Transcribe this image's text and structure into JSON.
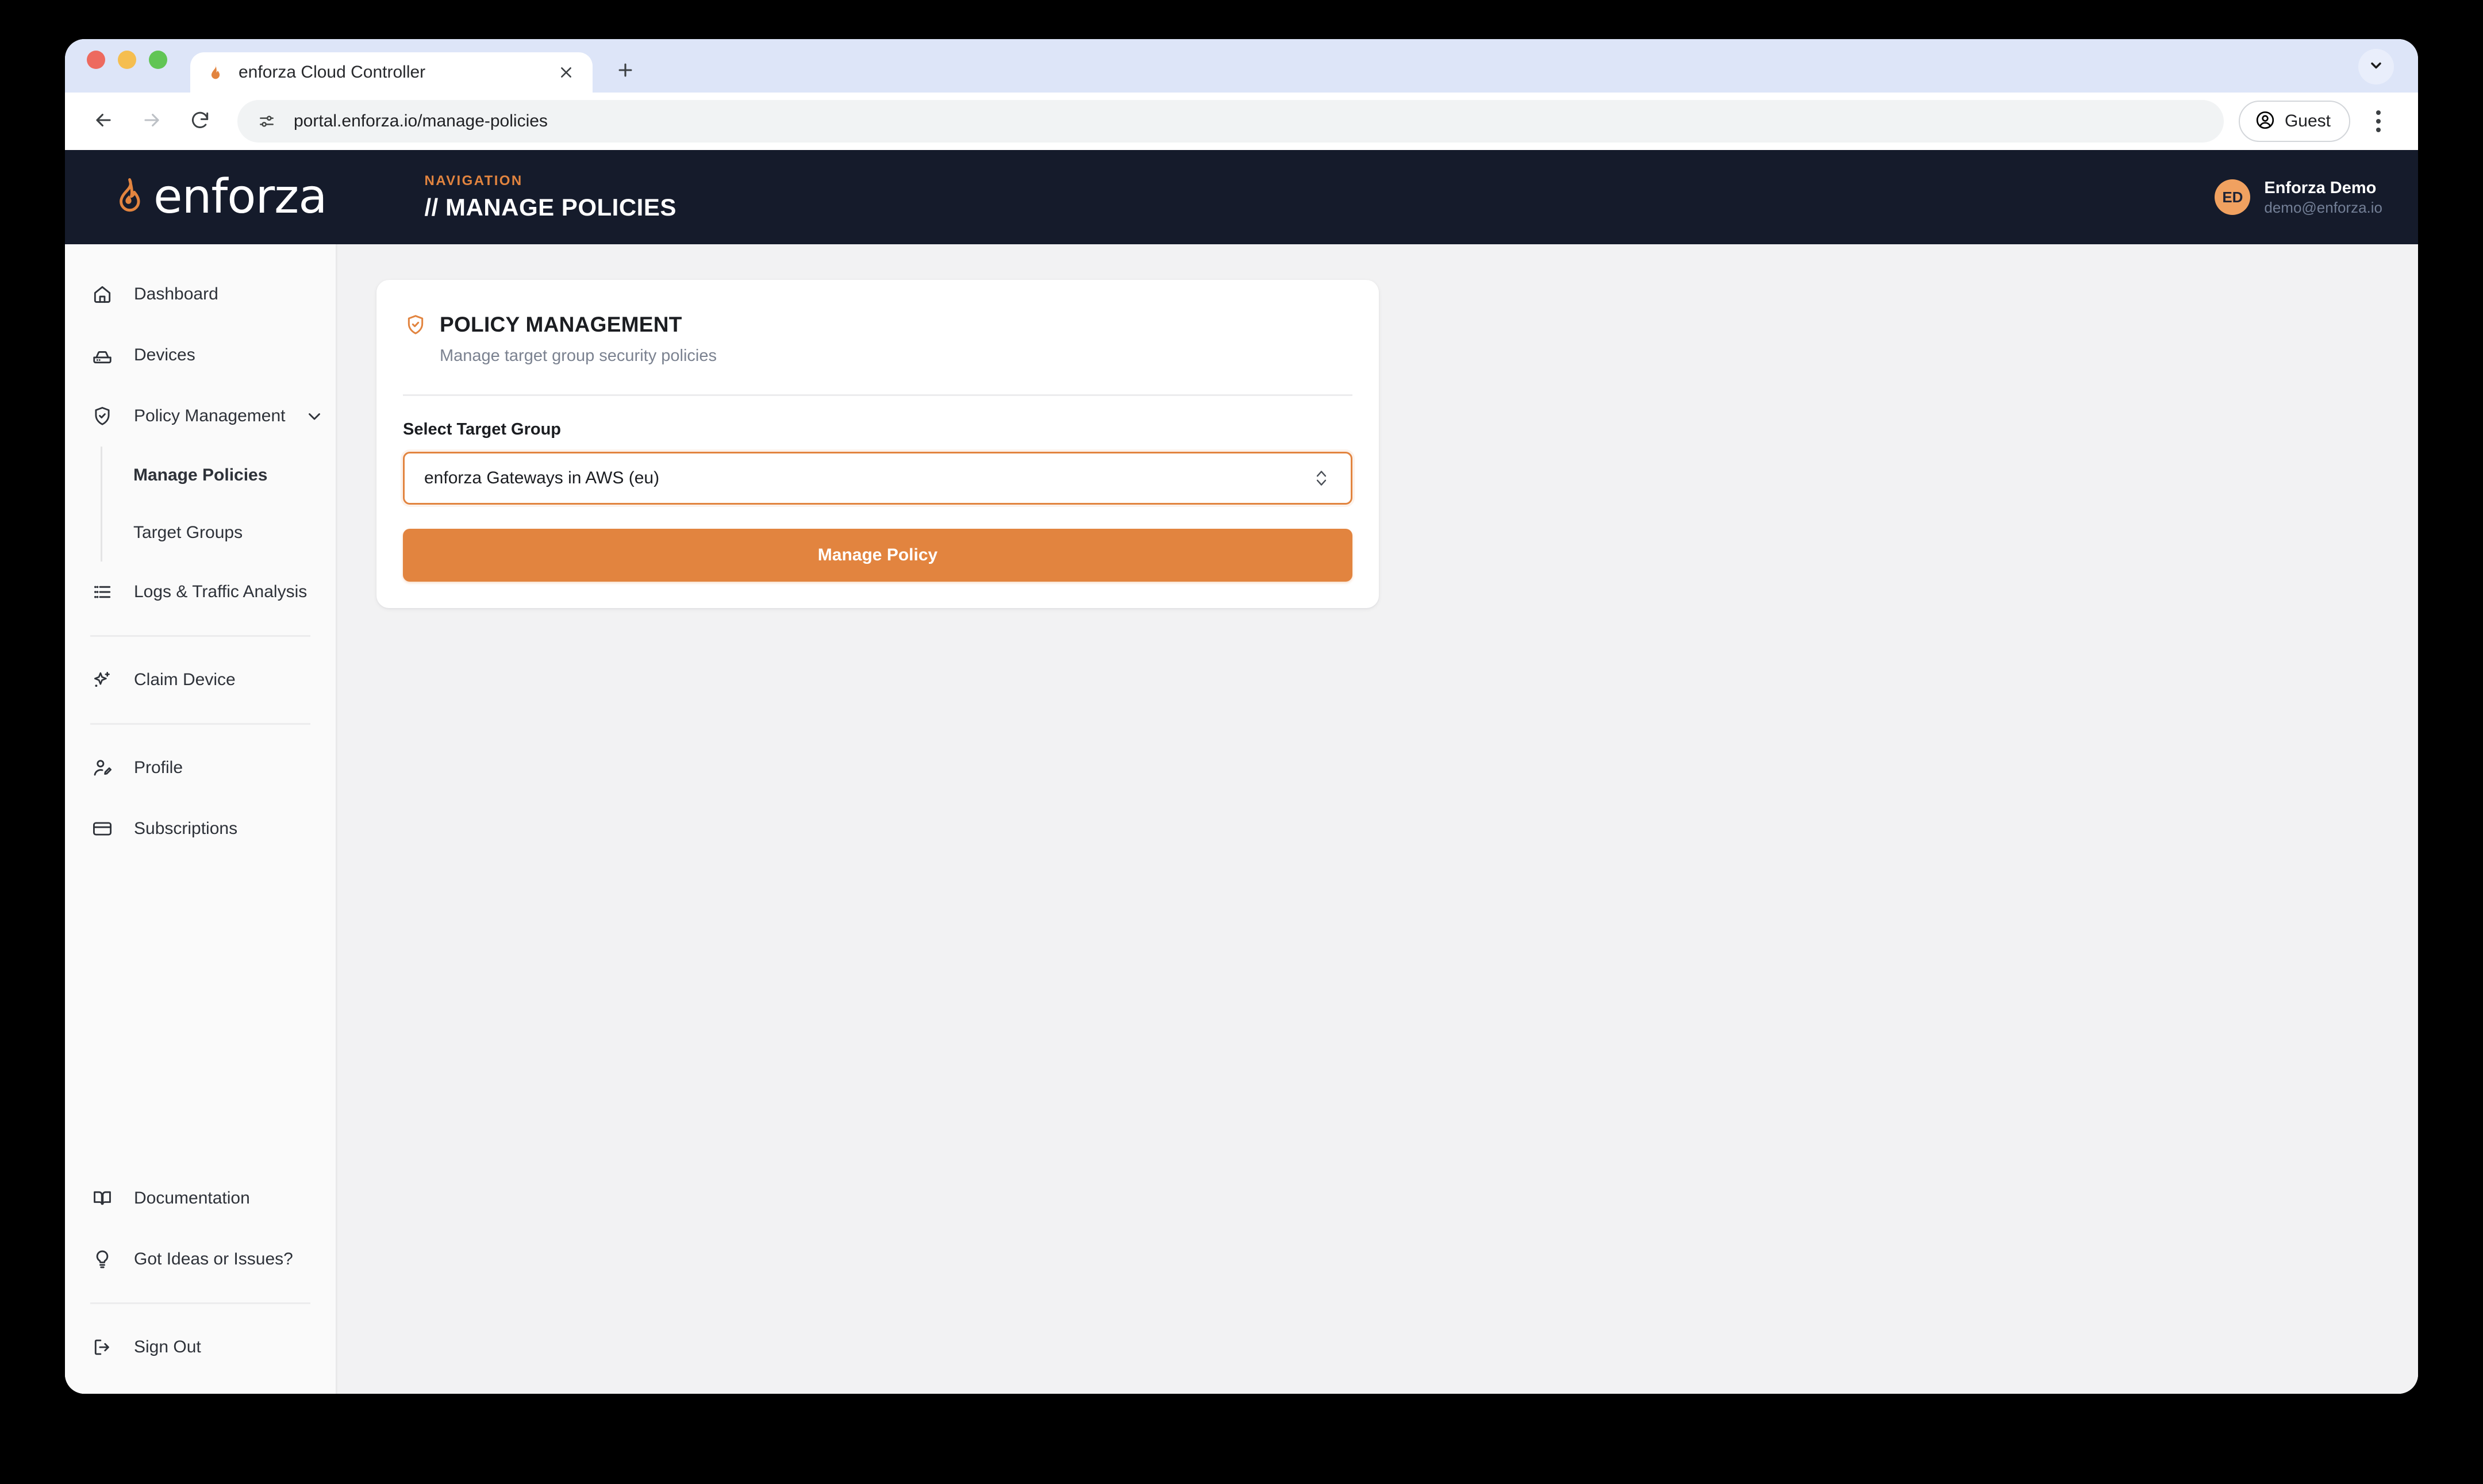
{
  "browser": {
    "tab": {
      "title": "enforza Cloud Controller",
      "favicon_icon": "flame-icon",
      "close_icon": "close-icon"
    },
    "new_tab_icon": "plus-icon",
    "tab_list_icon": "chevron-down-icon",
    "toolbar": {
      "back_icon": "arrow-left-icon",
      "forward_icon": "arrow-right-icon",
      "reload_icon": "reload-icon",
      "site_info_icon": "site-settings-icon",
      "url": "portal.enforza.io/manage-policies",
      "profile_label": "Guest",
      "profile_icon": "user-circle-icon",
      "menu_icon": "kebab-menu-icon"
    }
  },
  "header": {
    "logo_icon": "flame-icon",
    "logo_text": "enforza",
    "kicker": "NAVIGATION",
    "title": "// MANAGE POLICIES",
    "user": {
      "initials": "ED",
      "name": "Enforza Demo",
      "email": "demo@enforza.io"
    }
  },
  "sidebar": {
    "items": [
      {
        "label": "Dashboard",
        "icon": "home-icon"
      },
      {
        "label": "Devices",
        "icon": "server-icon"
      },
      {
        "label": "Policy Management",
        "icon": "shield-check-icon",
        "chevron": "chevron-down-icon"
      },
      {
        "label": "Logs & Traffic Analysis",
        "icon": "list-icon"
      },
      {
        "label": "Claim Device",
        "icon": "sparkles-icon"
      },
      {
        "label": "Profile",
        "icon": "user-pen-icon"
      },
      {
        "label": "Subscriptions",
        "icon": "credit-card-icon"
      },
      {
        "label": "Documentation",
        "icon": "book-icon"
      },
      {
        "label": "Got Ideas or Issues?",
        "icon": "lightbulb-icon"
      },
      {
        "label": "Sign Out",
        "icon": "logout-icon"
      }
    ],
    "subitems": [
      {
        "label": "Manage Policies",
        "active": true
      },
      {
        "label": "Target Groups",
        "active": false
      }
    ]
  },
  "card": {
    "icon": "shield-check-icon",
    "title": "POLICY MANAGEMENT",
    "subtitle": "Manage target group security policies",
    "field_label": "Select Target Group",
    "selected_target_group": "enforza Gateways in AWS (eu)",
    "select_chevron_icon": "chevron-up-down-icon",
    "button_label": "Manage Policy"
  },
  "colors": {
    "brand_orange": "#e2843f",
    "header_navy": "#151b2b",
    "avatar_orange": "#f0a160",
    "page_bg": "#f2f2f3",
    "sidebar_bg": "#fafafa"
  }
}
